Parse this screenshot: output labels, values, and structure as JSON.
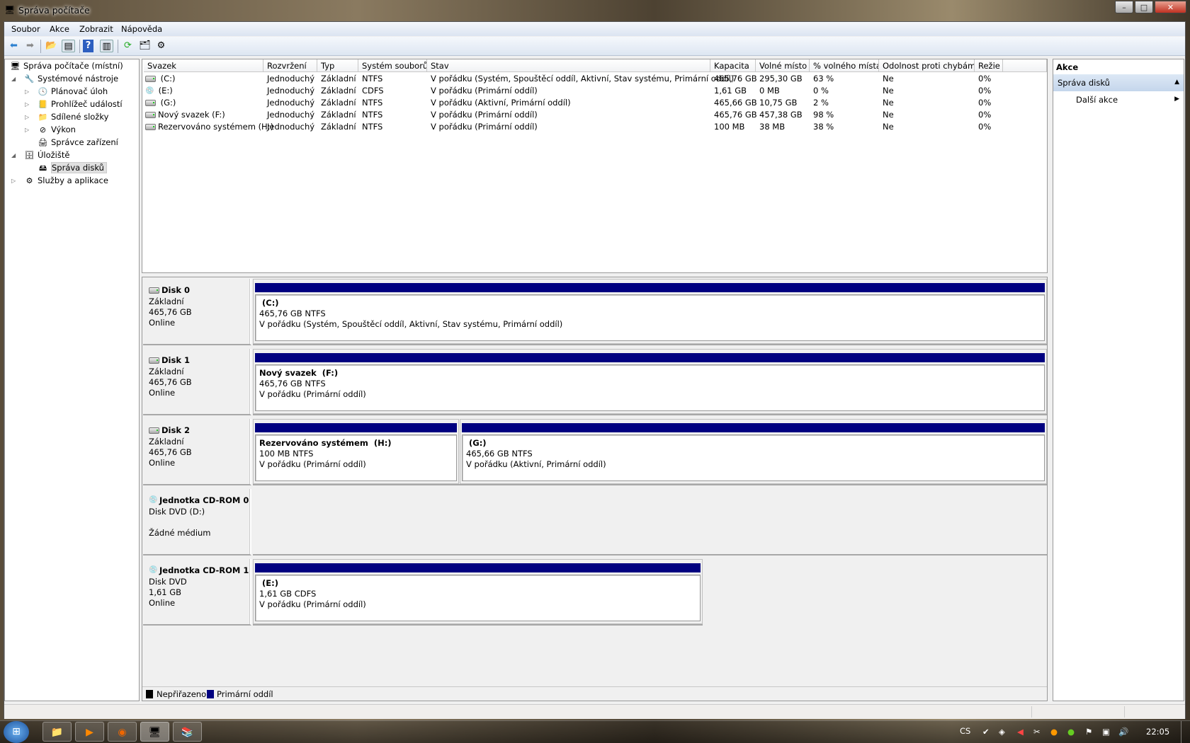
{
  "window": {
    "title": "Správa počítače",
    "minimize": "–",
    "maximize": "□",
    "close": "✕"
  },
  "menu": [
    "Soubor",
    "Akce",
    "Zobrazit",
    "Nápověda"
  ],
  "tree": [
    {
      "label": "Správa počítače (místní)",
      "icon": "computer-management-icon",
      "glyph": "🖥"
    },
    {
      "label": "Systémové nástroje",
      "icon": "tools-icon",
      "glyph": "🔧",
      "expander": "◢"
    },
    {
      "label": "Plánovač úloh",
      "icon": "clock-icon",
      "glyph": "🕓",
      "expander": "▷"
    },
    {
      "label": "Prohlížeč událostí",
      "icon": "event-viewer-icon",
      "glyph": "📒",
      "expander": "▷"
    },
    {
      "label": "Sdílené složky",
      "icon": "shared-folder-icon",
      "glyph": "📁",
      "expander": "▷"
    },
    {
      "label": "Výkon",
      "icon": "performance-icon",
      "glyph": "⊘",
      "expander": "▷"
    },
    {
      "label": "Správce zařízení",
      "icon": "device-manager-icon",
      "glyph": "🖨"
    },
    {
      "label": "Úložiště",
      "icon": "storage-icon",
      "glyph": "🗄",
      "expander": "◢"
    },
    {
      "label": "Správa disků",
      "icon": "disk-management-icon",
      "glyph": "🖴"
    },
    {
      "label": "Služby a aplikace",
      "icon": "services-icon",
      "glyph": "⚙",
      "expander": "▷"
    }
  ],
  "volumes": {
    "columns": [
      "Svazek",
      "Rozvržení",
      "Typ",
      "Systém souborů",
      "Stav",
      "Kapacita",
      "Volné místo",
      "% volného místa",
      "Odolnost proti chybám",
      "Režie"
    ],
    "rows": [
      {
        "icon": "hdd",
        "cells": [
          " (C:)",
          "Jednoduchý",
          "Základní",
          "NTFS",
          "V pořádku (Systém, Spouštěcí oddíl, Aktivní, Stav systému, Primární oddíl)",
          "465,76 GB",
          "295,30 GB",
          "63 %",
          "Ne",
          "0%"
        ]
      },
      {
        "icon": "cd",
        "cells": [
          " (E:)",
          "Jednoduchý",
          "Základní",
          "CDFS",
          "V pořádku (Primární oddíl)",
          "1,61 GB",
          "0 MB",
          "0 %",
          "Ne",
          "0%"
        ]
      },
      {
        "icon": "hdd",
        "cells": [
          " (G:)",
          "Jednoduchý",
          "Základní",
          "NTFS",
          "V pořádku (Aktivní, Primární oddíl)",
          "465,66 GB",
          "10,75 GB",
          "2 %",
          "Ne",
          "0%"
        ]
      },
      {
        "icon": "hdd",
        "cells": [
          "Nový svazek (F:)",
          "Jednoduchý",
          "Základní",
          "NTFS",
          "V pořádku (Primární oddíl)",
          "465,76 GB",
          "457,38 GB",
          "98 %",
          "Ne",
          "0%"
        ]
      },
      {
        "icon": "hdd",
        "cells": [
          "Rezervováno systémem (H:)",
          "Jednoduchý",
          "Základní",
          "NTFS",
          "V pořádku (Primární oddíl)",
          "100 MB",
          "38 MB",
          "38 %",
          "Ne",
          "0%"
        ]
      }
    ]
  },
  "disks": [
    {
      "name": "Disk 0",
      "icon": "hdd",
      "lines": [
        "Základní",
        "465,76 GB",
        "Online"
      ],
      "partitions": [
        {
          "title": " (C:)",
          "size": "465,76 GB NTFS",
          "status": "V pořádku (Systém, Spouštěcí oddíl, Aktivní, Stav systému, Primární oddíl)"
        }
      ]
    },
    {
      "name": "Disk 1",
      "icon": "hdd",
      "lines": [
        "Základní",
        "465,76 GB",
        "Online"
      ],
      "partitions": [
        {
          "title": "Nový svazek  (F:)",
          "size": "465,76 GB NTFS",
          "status": "V pořádku (Primární oddíl)"
        }
      ]
    },
    {
      "name": "Disk 2",
      "icon": "hdd",
      "lines": [
        "Základní",
        "465,76 GB",
        "Online"
      ],
      "partitions": [
        {
          "title": "Rezervováno systémem  (H:)",
          "size": "100 MB NTFS",
          "status": "V pořádku (Primární oddíl)"
        },
        {
          "title": " (G:)",
          "size": "465,66 GB NTFS",
          "status": "V pořádku (Aktivní, Primární oddíl)"
        }
      ]
    },
    {
      "name": "Jednotka CD-ROM 0",
      "icon": "cd",
      "lines": [
        "Disk DVD (D:)",
        "",
        "Žádné médium"
      ],
      "partitions": []
    },
    {
      "name": "Jednotka CD-ROM 1",
      "icon": "cd",
      "lines": [
        "Disk DVD",
        "1,61 GB",
        "Online"
      ],
      "partitions": [
        {
          "title": " (E:)",
          "size": "1,61 GB CDFS",
          "status": "V pořádku (Primární oddíl)"
        }
      ]
    }
  ],
  "legend": [
    {
      "label": "Nepřiřazeno",
      "color": "#000000"
    },
    {
      "label": "Primární oddíl",
      "color": "#000080"
    }
  ],
  "actions": {
    "header": "Akce",
    "section": "Správa disků",
    "section_arrow": "▲",
    "item": "Další akce",
    "item_arrow": "▶"
  },
  "taskbar": {
    "language": "CS",
    "clock": "22:05"
  }
}
